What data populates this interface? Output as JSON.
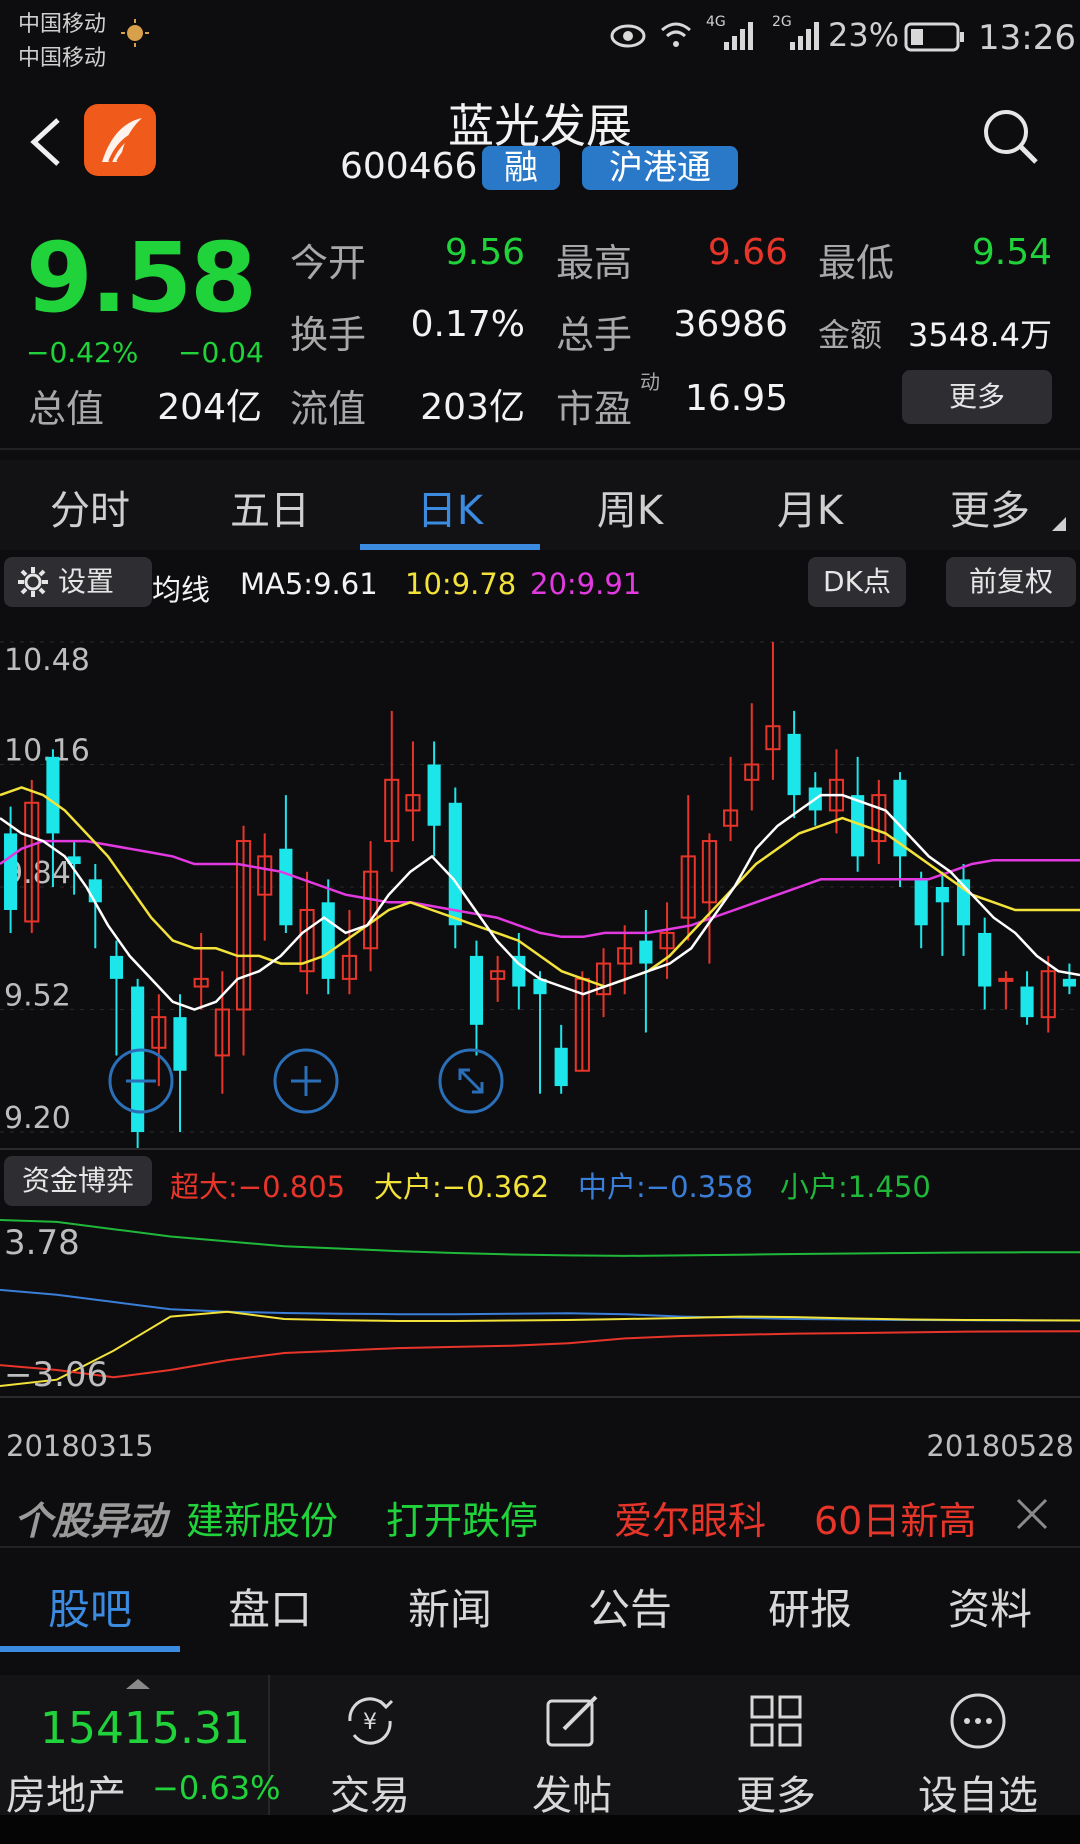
{
  "status": {
    "carrier1": "中国移动",
    "carrier2": "中国移动",
    "network1": "4G",
    "network2": "2G",
    "battery": "23%",
    "time": "13:26"
  },
  "header": {
    "name": "蓝光发展",
    "code": "600466",
    "tag1": "融",
    "tag2": "沪港通"
  },
  "quote": {
    "price": "9.58",
    "pct": "−0.42%",
    "chg": "−0.04",
    "labels": {
      "open": "今开",
      "high": "最高",
      "low": "最低",
      "turnover": "换手",
      "volume": "总手",
      "amount": "金额",
      "mktcap": "总值",
      "float": "流值",
      "pe": "市盈",
      "pe_sup": "动"
    },
    "values": {
      "open": "9.56",
      "high": "9.66",
      "low": "9.54",
      "turnover": "0.17%",
      "volume": "36986",
      "amount": "3548.4万",
      "mktcap": "204亿",
      "float": "203亿",
      "pe": "16.95"
    },
    "more": "更多"
  },
  "tabs": [
    "分时",
    "五日",
    "日K",
    "周K",
    "月K",
    "更多"
  ],
  "chartbar": {
    "settings": "设置",
    "ma_label": "均线",
    "ma5": "MA5:9.61",
    "ma10": "10:9.78",
    "ma20": "20:9.91",
    "dk": "DK点",
    "fq": "前复权"
  },
  "colors": {
    "up": "#e8352a",
    "down": "#1ce6ea",
    "ma5": "#ffffff",
    "ma10": "#f2e23a",
    "ma20": "#e23ae0",
    "green": "#20d33a",
    "blue": "#3b8be0"
  },
  "price_axis": {
    "ticks": [
      "10.48",
      "10.16",
      "9.84",
      "9.52",
      "9.20"
    ]
  },
  "chart_data": {
    "type": "candlestick",
    "ylim": [
      9.2,
      10.48
    ],
    "candles": [
      [
        9.98,
        9.78,
        10.05,
        9.72
      ],
      [
        9.75,
        10.06,
        10.12,
        9.72
      ],
      [
        10.18,
        9.98,
        10.2,
        9.84
      ],
      [
        9.92,
        9.9,
        9.96,
        9.82
      ],
      [
        9.86,
        9.8,
        9.9,
        9.68
      ],
      [
        9.66,
        9.6,
        9.7,
        9.4
      ],
      [
        9.58,
        9.2,
        9.6,
        9.12
      ],
      [
        9.42,
        9.5,
        9.56,
        9.32
      ],
      [
        9.5,
        9.36,
        9.56,
        9.2
      ],
      [
        9.58,
        9.6,
        9.72,
        9.52
      ],
      [
        9.4,
        9.52,
        9.62,
        9.3
      ],
      [
        9.52,
        9.96,
        10.0,
        9.4
      ],
      [
        9.82,
        9.92,
        9.98,
        9.7
      ],
      [
        9.94,
        9.74,
        10.08,
        9.72
      ],
      [
        9.62,
        9.78,
        9.88,
        9.56
      ],
      [
        9.8,
        9.6,
        9.86,
        9.56
      ],
      [
        9.6,
        9.66,
        9.78,
        9.56
      ],
      [
        9.68,
        9.88,
        9.96,
        9.62
      ],
      [
        9.96,
        10.12,
        10.3,
        9.88
      ],
      [
        10.04,
        10.08,
        10.22,
        9.96
      ],
      [
        10.16,
        10.0,
        10.22,
        9.92
      ],
      [
        10.06,
        9.74,
        10.1,
        9.68
      ],
      [
        9.66,
        9.48,
        9.7,
        9.4
      ],
      [
        9.6,
        9.62,
        9.66,
        9.54
      ],
      [
        9.66,
        9.58,
        9.72,
        9.52
      ],
      [
        9.6,
        9.56,
        9.62,
        9.3
      ],
      [
        9.42,
        9.32,
        9.48,
        9.3
      ],
      [
        9.36,
        9.6,
        9.62,
        9.36
      ],
      [
        9.56,
        9.64,
        9.68,
        9.5
      ],
      [
        9.64,
        9.68,
        9.74,
        9.56
      ],
      [
        9.7,
        9.64,
        9.78,
        9.46
      ],
      [
        9.68,
        9.72,
        9.8,
        9.6
      ],
      [
        9.76,
        9.92,
        10.08,
        9.7
      ],
      [
        9.8,
        9.96,
        9.98,
        9.64
      ],
      [
        10.0,
        10.04,
        10.18,
        9.96
      ],
      [
        10.12,
        10.16,
        10.32,
        10.04
      ],
      [
        10.2,
        10.26,
        10.48,
        10.12
      ],
      [
        10.24,
        10.08,
        10.3,
        10.02
      ],
      [
        10.1,
        10.04,
        10.14,
        10.0
      ],
      [
        10.04,
        10.12,
        10.2,
        9.98
      ],
      [
        10.08,
        9.92,
        10.18,
        9.88
      ],
      [
        9.96,
        10.08,
        10.12,
        9.9
      ],
      [
        10.12,
        9.92,
        10.14,
        9.84
      ],
      [
        9.86,
        9.74,
        9.88,
        9.68
      ],
      [
        9.84,
        9.8,
        9.88,
        9.66
      ],
      [
        9.86,
        9.74,
        9.9,
        9.66
      ],
      [
        9.72,
        9.58,
        9.76,
        9.52
      ],
      [
        9.6,
        9.6,
        9.62,
        9.52
      ],
      [
        9.58,
        9.5,
        9.62,
        9.48
      ],
      [
        9.5,
        9.62,
        9.66,
        9.46
      ],
      [
        9.6,
        9.58,
        9.64,
        9.56
      ]
    ],
    "ma5": [
      10.02,
      9.98,
      9.96,
      9.92,
      9.84,
      9.74,
      9.66,
      9.6,
      9.54,
      9.52,
      9.54,
      9.6,
      9.62,
      9.66,
      9.72,
      9.76,
      9.72,
      9.74,
      9.82,
      9.88,
      9.92,
      9.86,
      9.78,
      9.7,
      9.64,
      9.6,
      9.58,
      9.56,
      9.58,
      9.6,
      9.62,
      9.64,
      9.68,
      9.76,
      9.84,
      9.94,
      10.0,
      10.04,
      10.08,
      10.08,
      10.06,
      10.04,
      9.98,
      9.92,
      9.88,
      9.82,
      9.76,
      9.72,
      9.66,
      9.62,
      9.61
    ],
    "ma10": [
      10.08,
      10.1,
      10.08,
      10.04,
      9.98,
      9.92,
      9.84,
      9.76,
      9.7,
      9.68,
      9.68,
      9.66,
      9.66,
      9.64,
      9.64,
      9.66,
      9.7,
      9.74,
      9.78,
      9.8,
      9.78,
      9.76,
      9.74,
      9.72,
      9.7,
      9.66,
      9.62,
      9.6,
      9.58,
      9.6,
      9.62,
      9.66,
      9.72,
      9.78,
      9.84,
      9.9,
      9.94,
      9.98,
      10.0,
      10.02,
      10.0,
      9.98,
      9.94,
      9.9,
      9.86,
      9.82,
      9.8,
      9.78,
      9.78,
      9.78,
      9.78
    ],
    "ma20": [
      9.9,
      9.94,
      9.96,
      9.96,
      9.96,
      9.95,
      9.94,
      9.93,
      9.92,
      9.9,
      9.9,
      9.9,
      9.89,
      9.88,
      9.86,
      9.84,
      9.82,
      9.81,
      9.8,
      9.8,
      9.79,
      9.78,
      9.77,
      9.76,
      9.74,
      9.72,
      9.71,
      9.71,
      9.72,
      9.72,
      9.72,
      9.73,
      9.74,
      9.76,
      9.78,
      9.8,
      9.82,
      9.84,
      9.86,
      9.86,
      9.86,
      9.86,
      9.86,
      9.86,
      9.88,
      9.9,
      9.91,
      9.91,
      9.91,
      9.91,
      9.91
    ]
  },
  "fund": {
    "title": "资金博弈",
    "super": "超大:−0.805",
    "large": "大户:−0.362",
    "medium": "中户:−0.358",
    "small": "小户:1.450",
    "ymax": "3.78",
    "ymin": "−3.06",
    "series": {
      "small": [
        3.78,
        3.7,
        3.4,
        3.1,
        2.9,
        2.7,
        2.6,
        2.5,
        2.42,
        2.36,
        2.32,
        2.3,
        2.32,
        2.35,
        2.38,
        2.4,
        2.42,
        2.44,
        2.45,
        2.45
      ],
      "medium": [
        0.9,
        0.7,
        0.4,
        0.1,
        0.0,
        -0.05,
        -0.08,
        -0.1,
        -0.1,
        -0.08,
        -0.06,
        -0.1,
        -0.2,
        -0.25,
        -0.3,
        -0.32,
        -0.34,
        -0.35,
        -0.36,
        -0.36
      ],
      "large": [
        -3.06,
        -2.8,
        -1.6,
        -0.2,
        0.0,
        -0.3,
        -0.35,
        -0.38,
        -0.38,
        -0.36,
        -0.34,
        -0.3,
        -0.26,
        -0.2,
        -0.22,
        -0.28,
        -0.32,
        -0.34,
        -0.35,
        -0.36
      ],
      "super": [
        -2.2,
        -2.4,
        -2.7,
        -2.4,
        -2.0,
        -1.7,
        -1.6,
        -1.5,
        -1.45,
        -1.4,
        -1.3,
        -1.1,
        -1.0,
        -0.95,
        -0.9,
        -0.88,
        -0.85,
        -0.82,
        -0.81,
        -0.8
      ]
    }
  },
  "dates": {
    "start": "20180315",
    "end": "20180528"
  },
  "alert": {
    "title": "个股异动",
    "s1_name": "建新股份",
    "s1_event": "打开跌停",
    "s2_name": "爱尔眼科",
    "s2_event": "60日新高"
  },
  "bottom_tabs": [
    "股吧",
    "盘口",
    "新闻",
    "公告",
    "研报",
    "资料"
  ],
  "footer": {
    "index_value": "15415.31",
    "index_name": "房地产",
    "index_chg": "−0.63%",
    "trade": "交易",
    "post": "发帖",
    "more": "更多",
    "add": "设自选"
  }
}
